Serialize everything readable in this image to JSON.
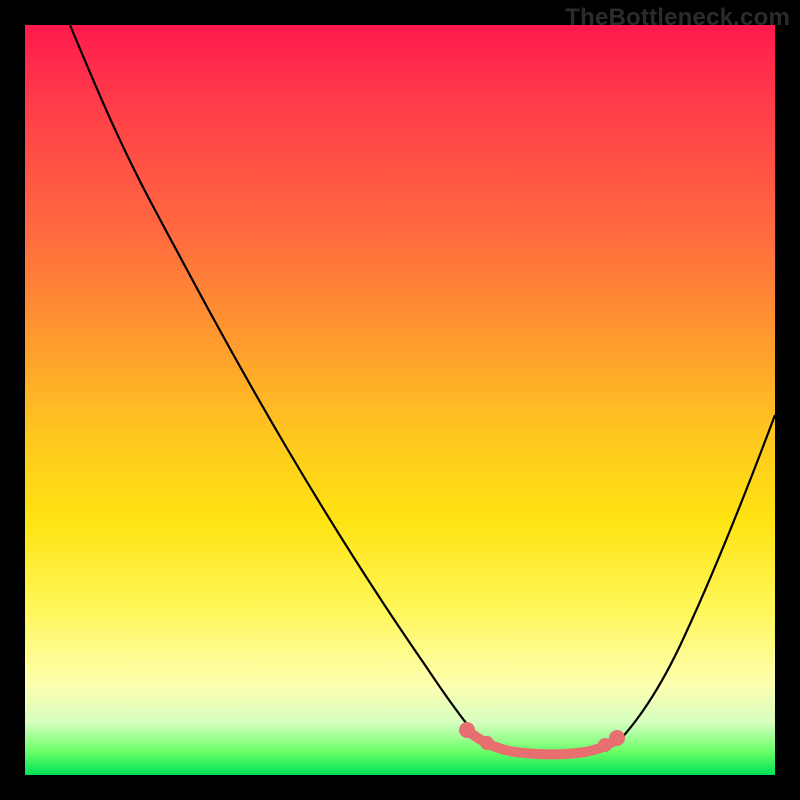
{
  "watermark": "TheBottleneck.com",
  "chart_data": {
    "type": "line",
    "title": "",
    "xlabel": "",
    "ylabel": "",
    "xlim": [
      0,
      100
    ],
    "ylim": [
      0,
      100
    ],
    "grid": false,
    "legend": false,
    "series": [
      {
        "name": "bottleneck-curve",
        "x": [
          0,
          5,
          10,
          15,
          20,
          25,
          30,
          35,
          40,
          45,
          50,
          55,
          60,
          62,
          65,
          70,
          75,
          80,
          85,
          90,
          95,
          100
        ],
        "values": [
          100,
          94,
          86,
          78,
          69,
          60,
          51,
          42,
          33,
          25,
          17,
          10,
          5,
          3,
          3,
          3,
          4,
          8,
          18,
          30,
          42,
          55
        ]
      }
    ],
    "highlight": {
      "name": "optimal-range",
      "x": [
        58,
        60,
        62,
        65,
        68,
        70,
        72,
        75,
        78
      ],
      "values": [
        6,
        4.5,
        3.5,
        3.2,
        3.2,
        3.3,
        3.8,
        4.5,
        6
      ]
    },
    "background_gradient": [
      "#ff1a4d",
      "#ff6b3f",
      "#ffc81f",
      "#fff75a",
      "#66ff66",
      "#00e05a"
    ]
  }
}
